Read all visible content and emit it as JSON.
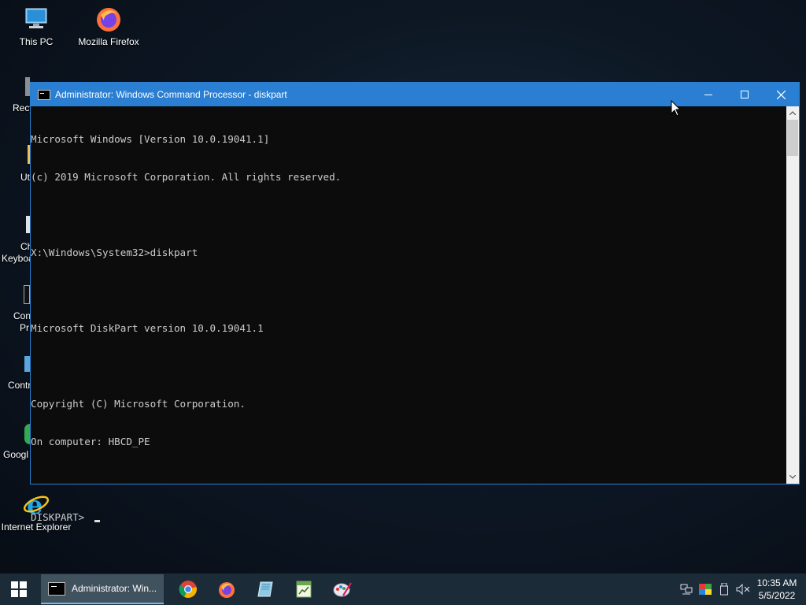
{
  "desktop": {
    "icons": [
      {
        "label": "This PC"
      },
      {
        "label": "Mozilla Firefox"
      },
      {
        "label": "Internet Explorer"
      }
    ],
    "peek_labels": [
      "Recy",
      "Uti",
      "Ch",
      "Keyboa",
      "Con",
      "Pr",
      "Contr",
      "Googl"
    ]
  },
  "window": {
    "title": "Administrator: Windows Command Processor - diskpart",
    "console_lines": [
      "Microsoft Windows [Version 10.0.19041.1]",
      "(c) 2019 Microsoft Corporation. All rights reserved.",
      "",
      "X:\\Windows\\System32>diskpart",
      "",
      "Microsoft DiskPart version 10.0.19041.1",
      "",
      "Copyright (C) Microsoft Corporation.",
      "On computer: HBCD_PE",
      "",
      "DISKPART> "
    ]
  },
  "taskbar": {
    "active_task_label": "Administrator: Win...",
    "pinned": [
      "chrome-icon",
      "firefox-icon",
      "notepad-icon",
      "spreadsheet-icon",
      "paint-icon"
    ],
    "clock": {
      "time": "10:35 AM",
      "date": "5/5/2022"
    }
  },
  "colors": {
    "accent": "#2b7fd3",
    "console_bg": "#0c0c0c",
    "console_text": "#cccccc",
    "taskbar_bg": "#1c2b38"
  }
}
